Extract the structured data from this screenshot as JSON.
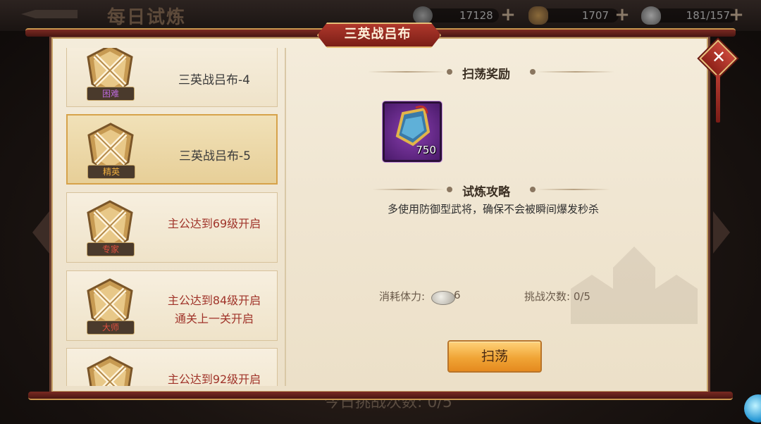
{
  "topbar": {
    "title": "每日试炼",
    "resources": [
      {
        "icon": "coin-icon",
        "value": "17128"
      },
      {
        "icon": "ingot-icon",
        "value": "1707"
      },
      {
        "icon": "stamina-icon",
        "value": "181/157"
      }
    ]
  },
  "panel": {
    "title": "三英战吕布"
  },
  "stages": [
    {
      "name": "三英战吕布-4",
      "rank": "困难",
      "unlocked": true
    },
    {
      "name": "三英战吕布-5",
      "rank": "精英",
      "unlocked": true,
      "selected": true
    },
    {
      "name": "主公达到69级开启",
      "rank": "专家",
      "unlocked": false
    },
    {
      "name": "主公达到84级开启",
      "name2": "通关上一关开启",
      "rank": "大师",
      "unlocked": false
    },
    {
      "name": "主公达到92级开启",
      "rank": "",
      "unlocked": false
    }
  ],
  "detail": {
    "reward_heading": "扫荡奖励",
    "reward_item": {
      "icon": "shield-badge-icon",
      "count": "750"
    },
    "strategy_heading": "试炼攻略",
    "strategy_text": "多使用防御型武将，确保不会被瞬间爆发秒杀",
    "cost_label": "消耗体力:",
    "cost_value": "6",
    "tries": "挑战次数: 0/5",
    "sweep_button": "扫荡"
  },
  "background": {
    "peek_text": "今日挑战次数: 0/5"
  },
  "colors": {
    "accent_red": "#a0342a",
    "button_orange": "#f0a536",
    "reward_purple": "#6a2a8a"
  }
}
